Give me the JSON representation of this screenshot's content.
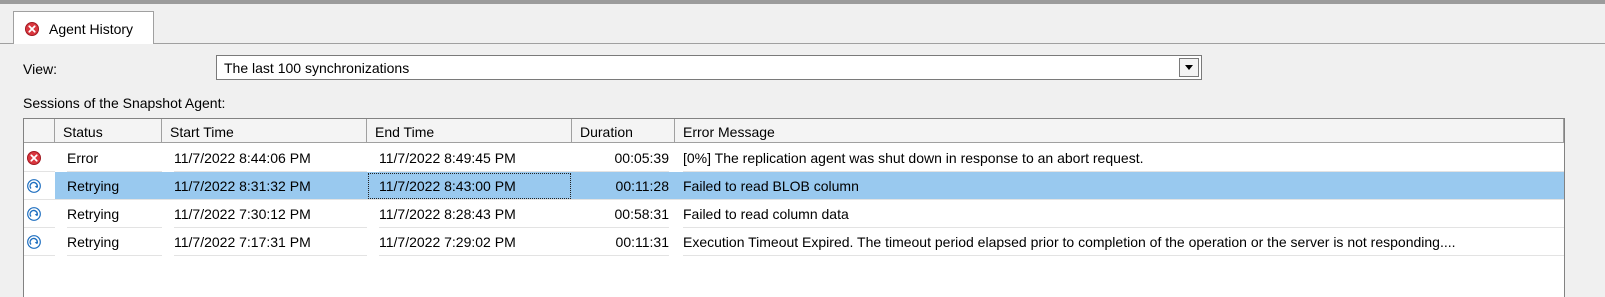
{
  "tab": {
    "label": "Agent History",
    "icon": "error-icon"
  },
  "view": {
    "label": "View:",
    "selected": "The last 100 synchronizations"
  },
  "sessions_label": "Sessions of the Snapshot Agent:",
  "columns": [
    "Status",
    "Start Time",
    "End Time",
    "Duration",
    "Error Message"
  ],
  "rows": [
    {
      "icon": "error-icon",
      "status": "Error",
      "start": "11/7/2022 8:44:06 PM",
      "end": "11/7/2022 8:49:45 PM",
      "duration": "00:05:39",
      "message": "[0%] The replication agent was shut down in response to an abort request."
    },
    {
      "icon": "retry-icon",
      "status": "Retrying",
      "start": "11/7/2022 8:31:32 PM",
      "end": "11/7/2022 8:43:00 PM",
      "duration": "00:11:28",
      "message": "Failed to read BLOB column"
    },
    {
      "icon": "retry-icon",
      "status": "Retrying",
      "start": "11/7/2022 7:30:12 PM",
      "end": "11/7/2022 8:28:43 PM",
      "duration": "00:58:31",
      "message": "Failed to read column data"
    },
    {
      "icon": "retry-icon",
      "status": "Retrying",
      "start": "11/7/2022 7:17:31 PM",
      "end": "11/7/2022 7:29:02 PM",
      "duration": "00:11:31",
      "message": "Execution Timeout Expired.  The timeout period elapsed prior to completion of the operation or the server is not responding...."
    }
  ],
  "selected_row": 1,
  "colors": {
    "selection": "#99c9ef",
    "error_red": "#d9363e",
    "retry_blue": "#1e6fc0"
  }
}
